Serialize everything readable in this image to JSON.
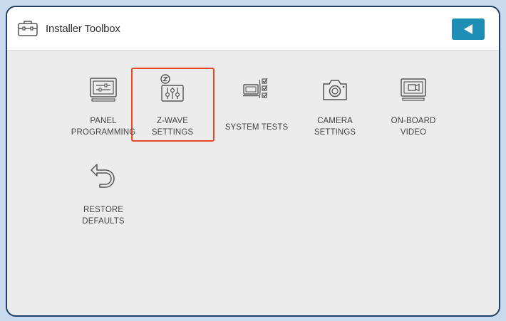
{
  "header": {
    "title": "Installer Toolbox",
    "title_icon": "toolbox-icon",
    "back_icon": "back-arrow-icon",
    "accent_color": "#1e8eb6"
  },
  "items": [
    {
      "line1": "PANEL",
      "line2": "PROGRAMMING",
      "icon": "panel-programming-icon"
    },
    {
      "line1": "Z-WAVE",
      "line2": "SETTINGS",
      "icon": "z-wave-sliders-icon",
      "highlighted": true
    },
    {
      "line1": "SYSTEM TESTS",
      "line2": "",
      "icon": "system-tests-checklist-icon"
    },
    {
      "line1": "CAMERA",
      "line2": "SETTINGS",
      "icon": "camera-icon"
    },
    {
      "line1": "ON-BOARD",
      "line2": "VIDEO",
      "icon": "video-camera-icon"
    },
    {
      "line1": "RESTORE",
      "line2": "DEFAULTS",
      "icon": "undo-arrow-icon"
    }
  ],
  "highlight_color": "#e5482a"
}
